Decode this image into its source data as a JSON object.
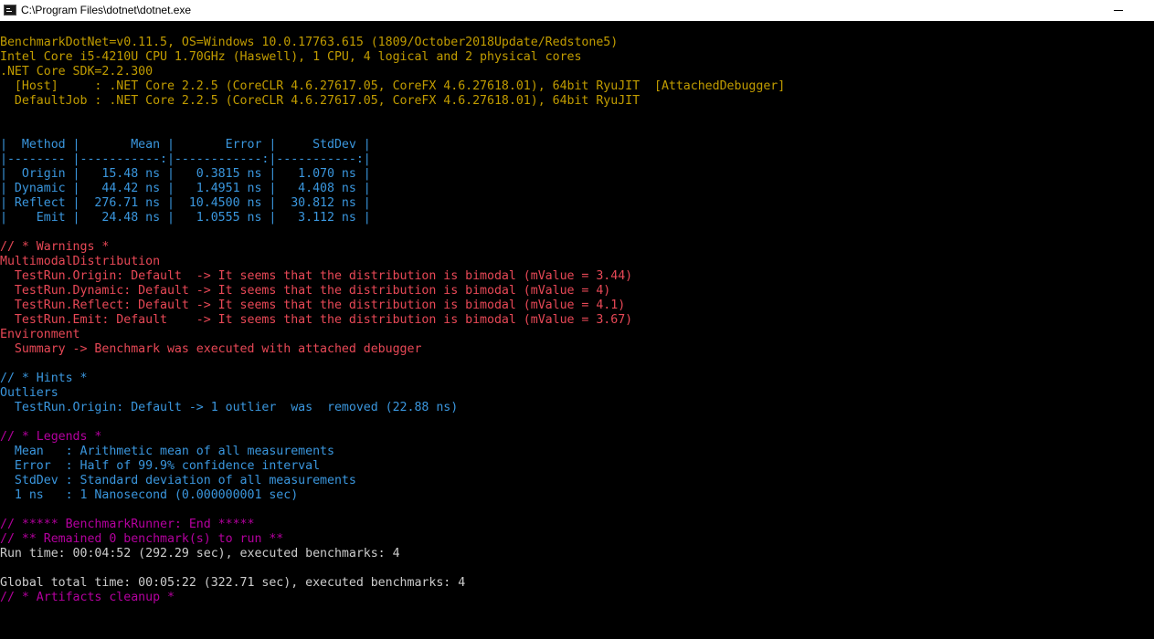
{
  "window": {
    "title": "C:\\Program Files\\dotnet\\dotnet.exe"
  },
  "console": {
    "lines": [
      {
        "text": "BenchmarkDotNet=v0.11.5, OS=Windows 10.0.17763.615 (1809/October2018Update/Redstone5)",
        "color": "yellow"
      },
      {
        "text": "Intel Core i5-4210U CPU 1.70GHz (Haswell), 1 CPU, 4 logical and 2 physical cores",
        "color": "yellow"
      },
      {
        "text": ".NET Core SDK=2.2.300",
        "color": "yellow"
      },
      {
        "text": "  [Host]     : .NET Core 2.2.5 (CoreCLR 4.6.27617.05, CoreFX 4.6.27618.01), 64bit RyuJIT  [AttachedDebugger]",
        "color": "yellow"
      },
      {
        "text": "  DefaultJob : .NET Core 2.2.5 (CoreCLR 4.6.27617.05, CoreFX 4.6.27618.01), 64bit RyuJIT",
        "color": "yellow"
      },
      {
        "text": "",
        "color": "white"
      },
      {
        "text": "",
        "color": "white"
      },
      {
        "text": "|  Method |       Mean |       Error |     StdDev |",
        "color": "cyan"
      },
      {
        "text": "|-------- |-----------:|------------:|-----------:|",
        "color": "cyan"
      },
      {
        "text": "|  Origin |   15.48 ns |   0.3815 ns |   1.070 ns |",
        "color": "cyan"
      },
      {
        "text": "| Dynamic |   44.42 ns |   1.4951 ns |   4.408 ns |",
        "color": "cyan"
      },
      {
        "text": "| Reflect |  276.71 ns |  10.4500 ns |  30.812 ns |",
        "color": "cyan"
      },
      {
        "text": "|    Emit |   24.48 ns |   1.0555 ns |   3.112 ns |",
        "color": "cyan"
      },
      {
        "text": "",
        "color": "white"
      },
      {
        "text": "// * Warnings *",
        "color": "red"
      },
      {
        "text": "MultimodalDistribution",
        "color": "red"
      },
      {
        "text": "  TestRun.Origin: Default  -> It seems that the distribution is bimodal (mValue = 3.44)",
        "color": "red"
      },
      {
        "text": "  TestRun.Dynamic: Default -> It seems that the distribution is bimodal (mValue = 4)",
        "color": "red"
      },
      {
        "text": "  TestRun.Reflect: Default -> It seems that the distribution is bimodal (mValue = 4.1)",
        "color": "red"
      },
      {
        "text": "  TestRun.Emit: Default    -> It seems that the distribution is bimodal (mValue = 3.67)",
        "color": "red"
      },
      {
        "text": "Environment",
        "color": "red"
      },
      {
        "text": "  Summary -> Benchmark was executed with attached debugger",
        "color": "red"
      },
      {
        "text": "",
        "color": "white"
      },
      {
        "text": "// * Hints *",
        "color": "cyan"
      },
      {
        "text": "Outliers",
        "color": "cyan"
      },
      {
        "text": "  TestRun.Origin: Default -> 1 outlier  was  removed (22.88 ns)",
        "color": "cyan"
      },
      {
        "text": "",
        "color": "white"
      },
      {
        "text": "// * Legends *",
        "color": "magenta"
      },
      {
        "text": "  Mean   : Arithmetic mean of all measurements",
        "color": "cyan"
      },
      {
        "text": "  Error  : Half of 99.9% confidence interval",
        "color": "cyan"
      },
      {
        "text": "  StdDev : Standard deviation of all measurements",
        "color": "cyan"
      },
      {
        "text": "  1 ns   : 1 Nanosecond (0.000000001 sec)",
        "color": "cyan"
      },
      {
        "text": "",
        "color": "white"
      },
      {
        "text": "// ***** BenchmarkRunner: End *****",
        "color": "magenta"
      },
      {
        "text": "// ** Remained 0 benchmark(s) to run **",
        "color": "magenta"
      },
      {
        "text": "Run time: 00:04:52 (292.29 sec), executed benchmarks: 4",
        "color": "white"
      },
      {
        "text": "",
        "color": "white"
      },
      {
        "text": "Global total time: 00:05:22 (322.71 sec), executed benchmarks: 4",
        "color": "white"
      },
      {
        "text": "// * Artifacts cleanup *",
        "color": "magenta"
      }
    ]
  }
}
